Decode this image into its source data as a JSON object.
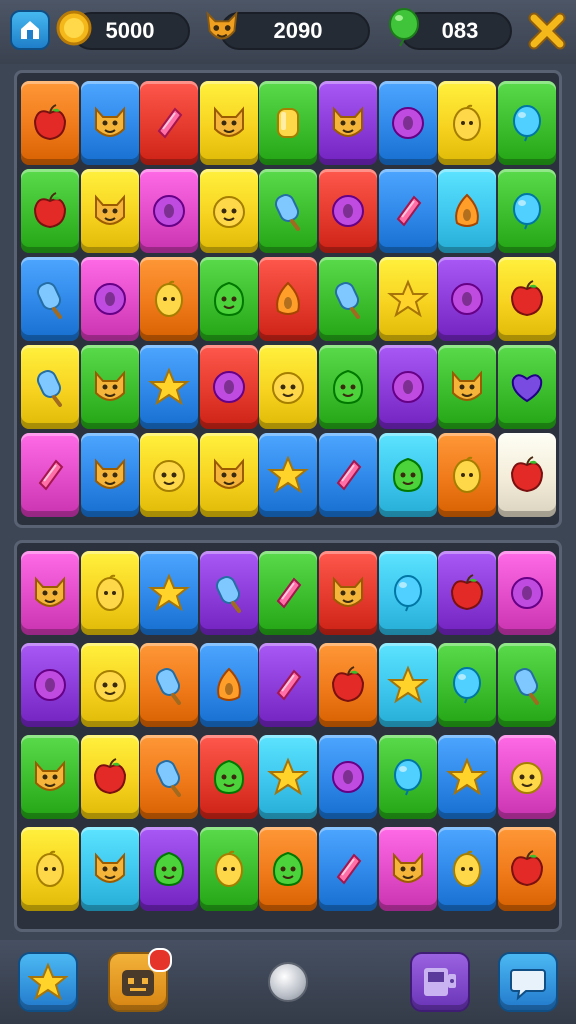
{
  "hud": {
    "coins": "5000",
    "trophies": "2090",
    "gems": "083"
  },
  "colors": {
    "red": "#e53a2e",
    "orange": "#f07a1a",
    "yellow": "#f7d320",
    "green": "#3bbd2e",
    "blue": "#2f88e8",
    "cyan": "#3ec6ee",
    "purple": "#8b3bd8",
    "pink": "#e24cc8",
    "cream": "#f3ecd8"
  },
  "board_top": {
    "rows": [
      [
        {
          "bg": "orange",
          "icon": "apple"
        },
        {
          "bg": "blue",
          "icon": "cat"
        },
        {
          "bg": "red",
          "icon": "gem"
        },
        {
          "bg": "yellow",
          "icon": "cat"
        },
        {
          "bg": "green",
          "icon": "bar"
        },
        {
          "bg": "purple",
          "icon": "cat"
        },
        {
          "bg": "blue",
          "icon": "donut"
        },
        {
          "bg": "yellow",
          "icon": "lemon"
        },
        {
          "bg": "green",
          "icon": "balloon"
        }
      ],
      [
        {
          "bg": "green",
          "icon": "apple"
        },
        {
          "bg": "yellow",
          "icon": "cat"
        },
        {
          "bg": "pink",
          "icon": "donut"
        },
        {
          "bg": "yellow",
          "icon": "face"
        },
        {
          "bg": "green",
          "icon": "popsicle"
        },
        {
          "bg": "red",
          "icon": "donut"
        },
        {
          "bg": "blue",
          "icon": "gem"
        },
        {
          "bg": "cyan",
          "icon": "triangle"
        },
        {
          "bg": "green",
          "icon": "balloon"
        }
      ],
      [
        {
          "bg": "blue",
          "icon": "popsicle"
        },
        {
          "bg": "pink",
          "icon": "donut"
        },
        {
          "bg": "orange",
          "icon": "lemon"
        },
        {
          "bg": "green",
          "icon": "blob"
        },
        {
          "bg": "red",
          "icon": "triangle"
        },
        {
          "bg": "green",
          "icon": "popsicle"
        },
        {
          "bg": "yellow",
          "icon": "star"
        },
        {
          "bg": "purple",
          "icon": "donut"
        },
        {
          "bg": "yellow",
          "icon": "apple"
        }
      ],
      [
        {
          "bg": "yellow",
          "icon": "popsicle"
        },
        {
          "bg": "green",
          "icon": "cat"
        },
        {
          "bg": "blue",
          "icon": "star"
        },
        {
          "bg": "red",
          "icon": "donut"
        },
        {
          "bg": "yellow",
          "icon": "face"
        },
        {
          "bg": "green",
          "icon": "blob"
        },
        {
          "bg": "purple",
          "icon": "donut"
        },
        {
          "bg": "green",
          "icon": "cat"
        },
        {
          "bg": "green",
          "icon": "heart"
        }
      ],
      [
        {
          "bg": "pink",
          "icon": "gem"
        },
        {
          "bg": "blue",
          "icon": "cat"
        },
        {
          "bg": "yellow",
          "icon": "face"
        },
        {
          "bg": "yellow",
          "icon": "cat"
        },
        {
          "bg": "blue",
          "icon": "star"
        },
        {
          "bg": "blue",
          "icon": "gem"
        },
        {
          "bg": "cyan",
          "icon": "blob"
        },
        {
          "bg": "orange",
          "icon": "lemon"
        },
        {
          "bg": "cream",
          "icon": "apple"
        }
      ]
    ]
  },
  "board_bottom": {
    "rows": [
      [
        {
          "bg": "pink",
          "icon": "cat"
        },
        {
          "bg": "yellow",
          "icon": "lemon"
        },
        {
          "bg": "blue",
          "icon": "star"
        },
        {
          "bg": "purple",
          "icon": "popsicle"
        },
        {
          "bg": "green",
          "icon": "gem"
        },
        {
          "bg": "red",
          "icon": "cat"
        },
        {
          "bg": "cyan",
          "icon": "balloon"
        },
        {
          "bg": "purple",
          "icon": "apple"
        },
        {
          "bg": "pink",
          "icon": "donut"
        }
      ],
      [
        {
          "bg": "purple",
          "icon": "donut"
        },
        {
          "bg": "yellow",
          "icon": "face"
        },
        {
          "bg": "orange",
          "icon": "popsicle"
        },
        {
          "bg": "blue",
          "icon": "triangle"
        },
        {
          "bg": "purple",
          "icon": "gem"
        },
        {
          "bg": "orange",
          "icon": "apple"
        },
        {
          "bg": "cyan",
          "icon": "star"
        },
        {
          "bg": "green",
          "icon": "balloon"
        },
        {
          "bg": "green",
          "icon": "popsicle"
        }
      ],
      [
        {
          "bg": "green",
          "icon": "cat"
        },
        {
          "bg": "yellow",
          "icon": "apple"
        },
        {
          "bg": "orange",
          "icon": "popsicle"
        },
        {
          "bg": "red",
          "icon": "blob"
        },
        {
          "bg": "cyan",
          "icon": "star"
        },
        {
          "bg": "blue",
          "icon": "donut"
        },
        {
          "bg": "green",
          "icon": "balloon"
        },
        {
          "bg": "blue",
          "icon": "star"
        },
        {
          "bg": "pink",
          "icon": "face"
        }
      ],
      [
        {
          "bg": "yellow",
          "icon": "lemon"
        },
        {
          "bg": "cyan",
          "icon": "cat"
        },
        {
          "bg": "purple",
          "icon": "blob"
        },
        {
          "bg": "green",
          "icon": "lemon"
        },
        {
          "bg": "orange",
          "icon": "blob"
        },
        {
          "bg": "blue",
          "icon": "gem"
        },
        {
          "bg": "pink",
          "icon": "cat"
        },
        {
          "bg": "blue",
          "icon": "lemon"
        },
        {
          "bg": "orange",
          "icon": "apple"
        }
      ]
    ]
  },
  "bottom_bar": {
    "buttons": [
      {
        "name": "star-button",
        "icon": "star-icon"
      },
      {
        "name": "inbox-button",
        "icon": "robot-icon",
        "badge": true
      },
      {
        "name": "center-button",
        "icon": "circle-icon"
      },
      {
        "name": "shop-button",
        "icon": "machine-icon"
      },
      {
        "name": "chat-button",
        "icon": "chat-icon"
      }
    ]
  }
}
